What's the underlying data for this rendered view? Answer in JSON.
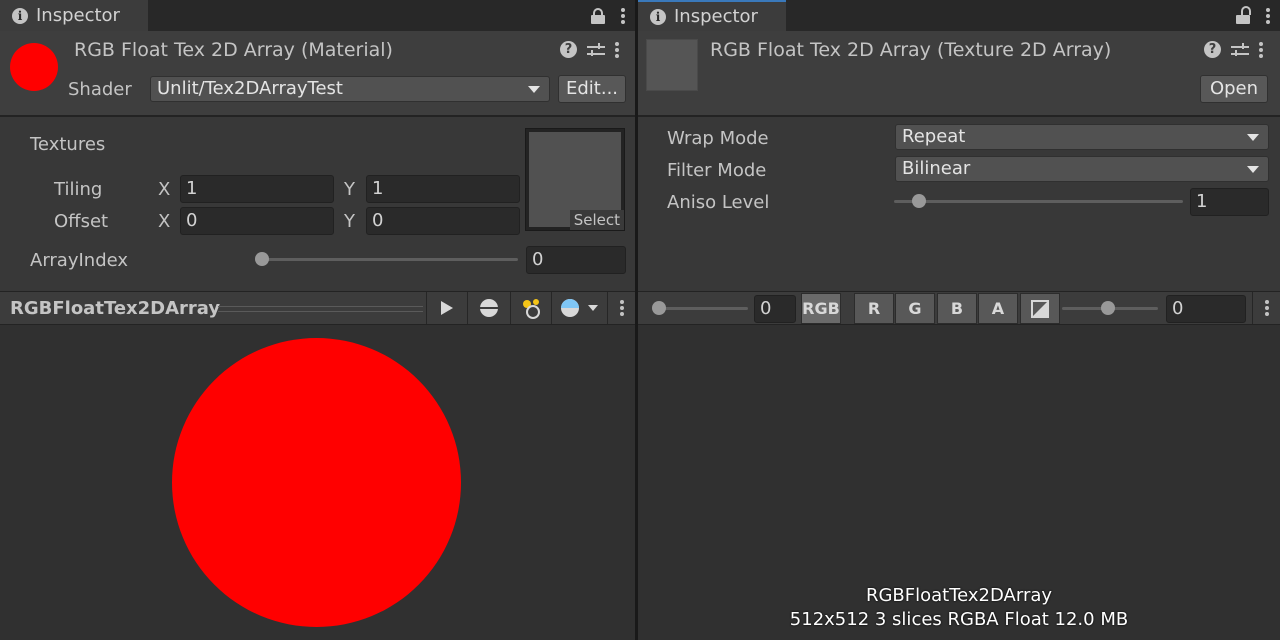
{
  "left": {
    "tab_label": "Inspector",
    "title": "RGB Float Tex 2D Array (Material)",
    "shader_label": "Shader",
    "shader_value": "Unlit/Tex2DArrayTest",
    "edit_button": "Edit...",
    "textures_label": "Textures",
    "tiling_label": "Tiling",
    "offset_label": "Offset",
    "axis_x": "X",
    "axis_y": "Y",
    "tiling_x": "1",
    "tiling_y": "1",
    "offset_x": "0",
    "offset_y": "0",
    "select_label": "Select",
    "array_index_label": "ArrayIndex",
    "array_index_value": "0",
    "array_index_slider_fraction": 0.0,
    "preview_title": "RGBFloatTex2DArray",
    "material_color": "#ff0000"
  },
  "right": {
    "tab_label": "Inspector",
    "title": "RGB Float Tex 2D Array (Texture 2D Array)",
    "open_button": "Open",
    "wrap_mode_label": "Wrap Mode",
    "wrap_mode_value": "Repeat",
    "filter_mode_label": "Filter Mode",
    "filter_mode_value": "Bilinear",
    "aniso_label": "Aniso Level",
    "aniso_value": "1",
    "mip_value": "0",
    "channels": [
      "RGB",
      "R",
      "G",
      "B",
      "A"
    ],
    "active_channel": "RGB",
    "slice_value": "0",
    "info_name": "RGBFloatTex2DArray",
    "info_details": "512x512 3 slices RGBA Float 12.0 MB"
  },
  "colors": {
    "accent": "#3a79bb",
    "panel_bg": "#383838",
    "preview_bg": "#303030"
  }
}
